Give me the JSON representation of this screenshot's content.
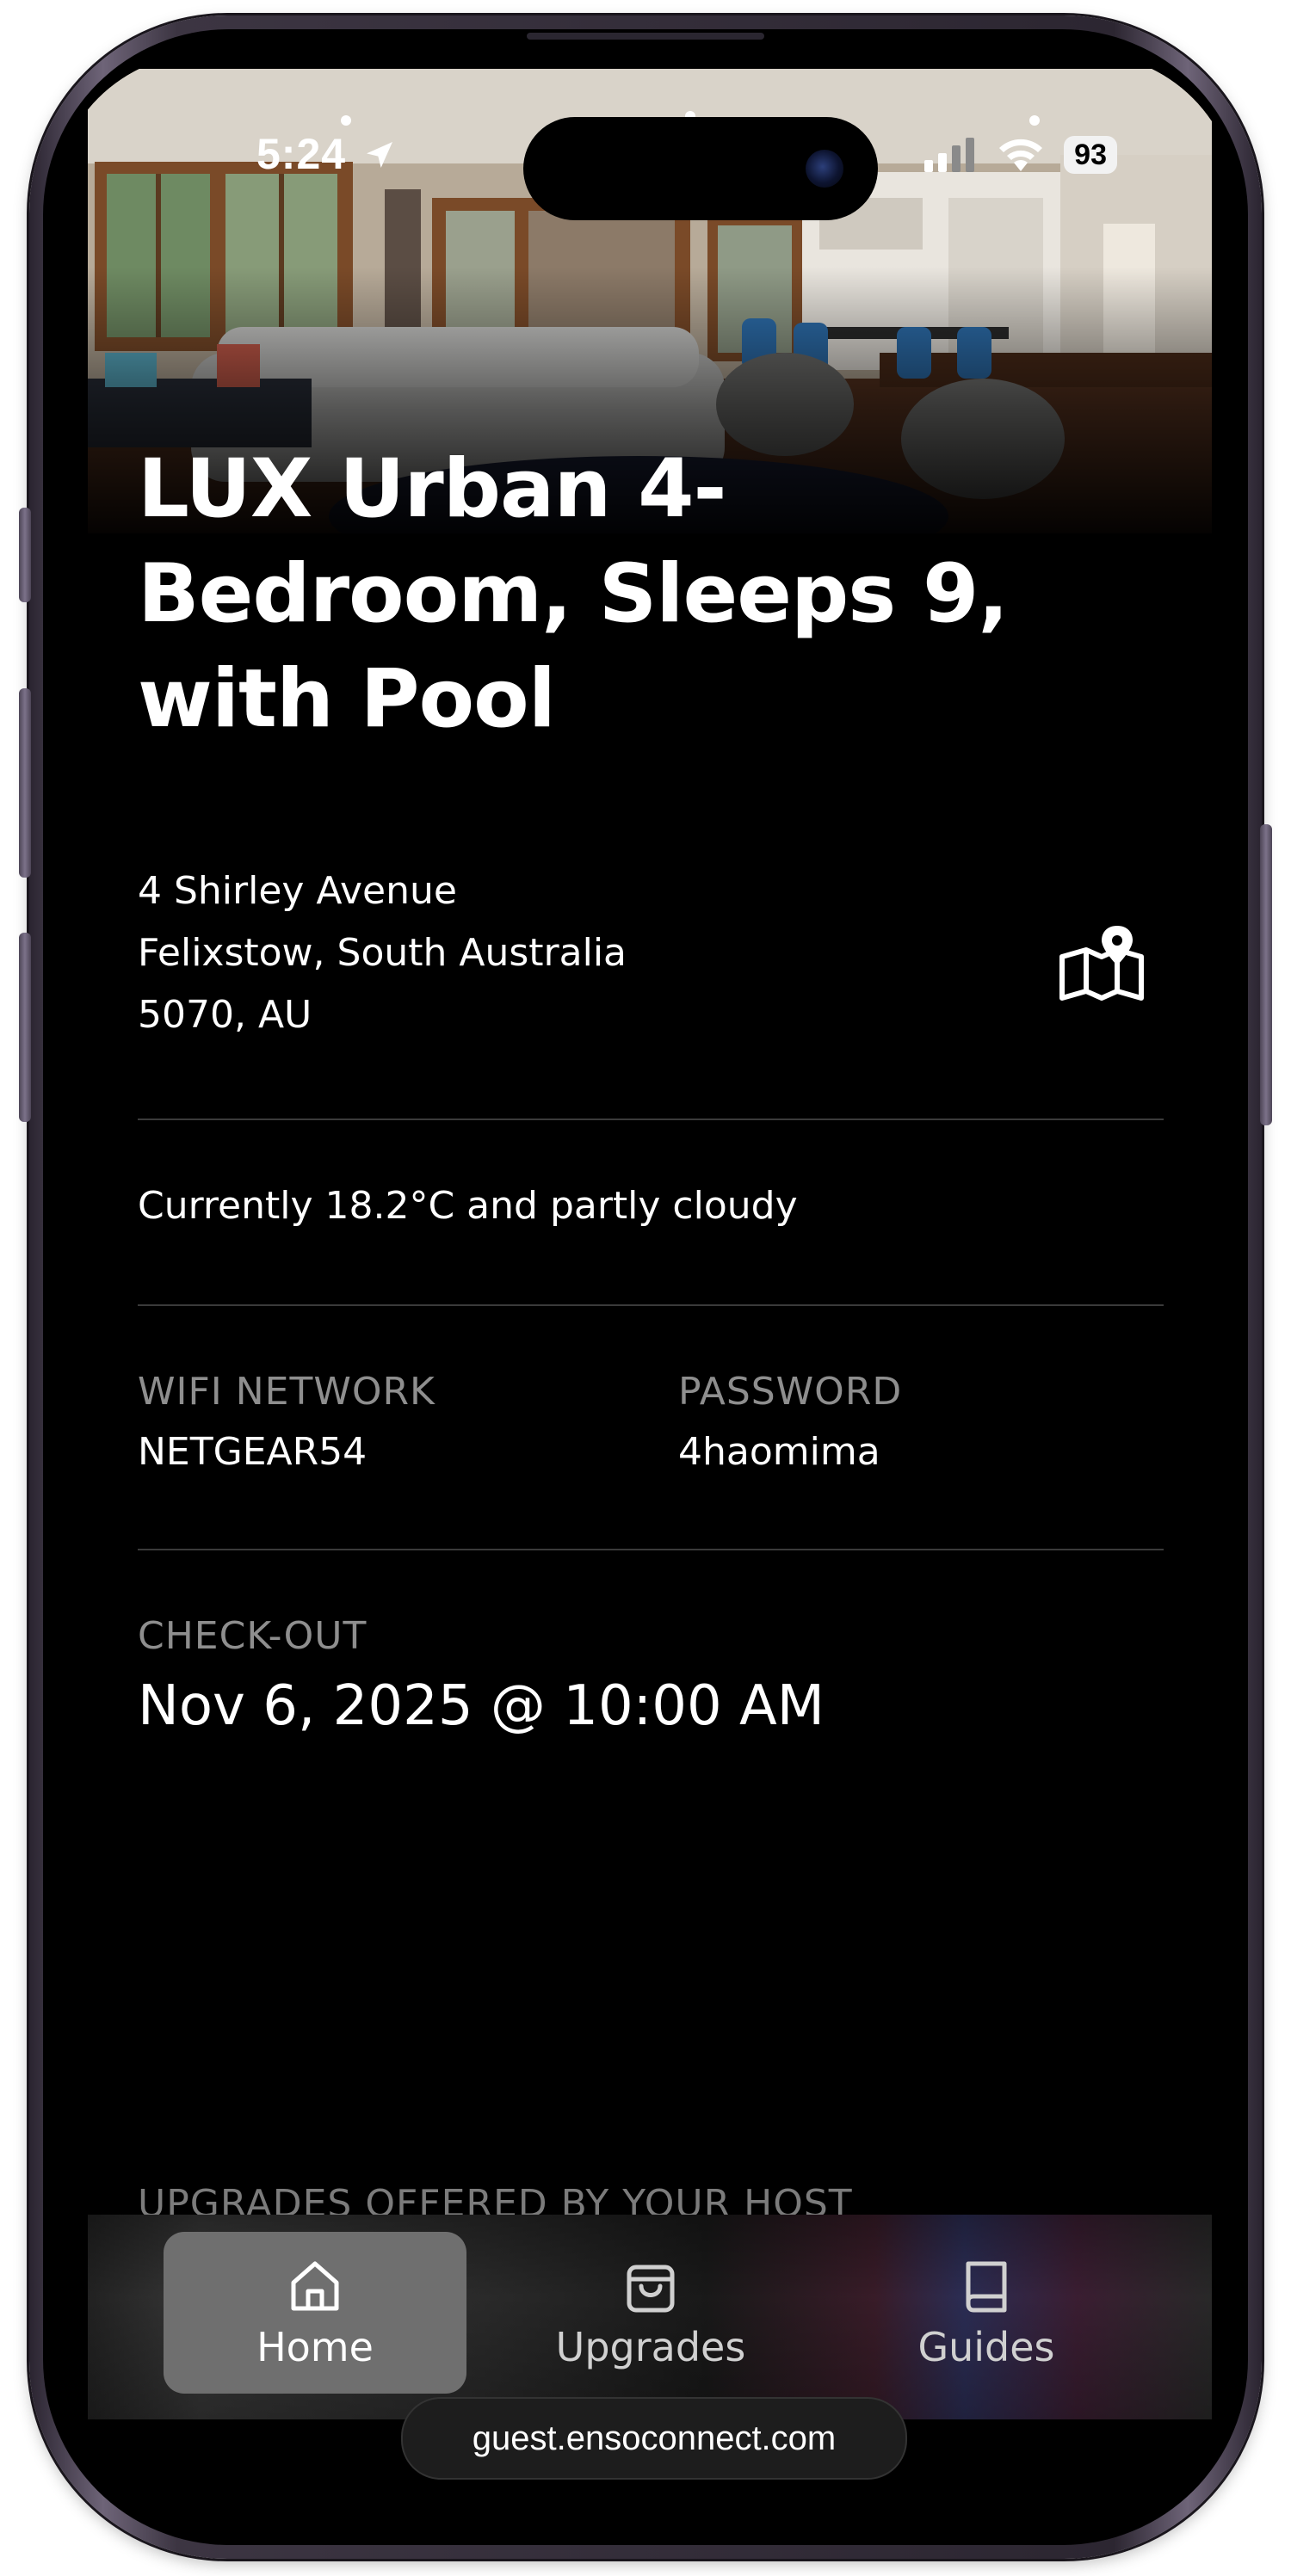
{
  "status_bar": {
    "time": "5:24",
    "battery": "93",
    "icons": [
      "location-arrow-icon",
      "cellular-signal-icon",
      "wifi-icon",
      "battery-icon"
    ]
  },
  "property": {
    "title": "LUX Urban 4-Bedroom, Sleeps 9, with Pool",
    "address_line1": "4 Shirley Avenue",
    "address_line2": "Felixstow, South Australia",
    "address_line3": "5070, AU"
  },
  "weather": {
    "text": "Currently 18.2°C and partly cloudy"
  },
  "wifi": {
    "network_label": "WIFI NETWORK",
    "network_value": "NETGEAR54",
    "password_label": "PASSWORD",
    "password_value": "4haomima"
  },
  "checkout": {
    "label": "CHECK-OUT",
    "value": "Nov 6, 2025 @ 10:00 AM"
  },
  "upgrades_section": {
    "heading": "UPGRADES OFFERED BY YOUR HOST"
  },
  "tabs": [
    {
      "label": "Home",
      "icon": "home-icon",
      "active": true
    },
    {
      "label": "Upgrades",
      "icon": "shopping-bag-icon",
      "active": false
    },
    {
      "label": "Guides",
      "icon": "book-icon",
      "active": false
    }
  ],
  "browser": {
    "url": "guest.ensoconnect.com"
  },
  "colors": {
    "background": "#000000",
    "text": "#ffffff",
    "muted_label": "#8e8e8e",
    "active_tab": "#6f6f6f"
  }
}
